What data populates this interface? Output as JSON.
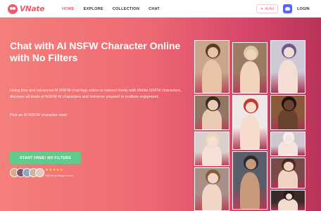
{
  "header": {
    "logo_text": "VNate",
    "nav": [
      {
        "label": "HOME",
        "active": true
      },
      {
        "label": "EXPLORE",
        "active": false
      },
      {
        "label": "COLLECTION",
        "active": false
      },
      {
        "label": "CHAT",
        "active": false
      }
    ],
    "ai_button_label": "AI Art",
    "login_label": "LOGIN"
  },
  "hero": {
    "title": "Chat with AI NSFW Character Online with No Filters",
    "description": "Using free and advanced AI NSFW chat App online to interact freely with lifelike NSFW characters, discover all kinds of NSFW AI characters and immerse yourself in endless enjoyment.",
    "cta_text": "Pick an AI NSFW character now!",
    "start_button_label": "START FREE! NO FILTERS",
    "stars": "★★★★★",
    "loved_text": "Still Been Ways Loved"
  },
  "colors": {
    "accent": "#ee5a6f",
    "hero_gradient_start": "#f47f7a",
    "hero_gradient_end": "#b9335a",
    "start_button": "#5fcb8c"
  },
  "gallery": [
    {
      "name": "character-image-1",
      "bg": "#c9a58a",
      "skin": "#e8c3a5",
      "hair": "#5a3a2a"
    },
    {
      "name": "character-image-2",
      "bg": "#9a7a63",
      "skin": "#f1d2bb",
      "hair": "#d9c9a2"
    },
    {
      "name": "character-image-3",
      "bg": "#cfc8d6",
      "skin": "#f4ddd4",
      "hair": "#6b5a8e"
    },
    {
      "name": "character-image-4",
      "bg": "#8f7763",
      "skin": "#e9cbb3",
      "hair": "#3a2a22"
    },
    {
      "name": "character-image-5",
      "bg": "#efe7e6",
      "skin": "#f6dccd",
      "hair": "#c23a2e"
    },
    {
      "name": "character-image-6",
      "bg": "#8a5a3a",
      "skin": "#6a4330",
      "hair": "#1f1410"
    },
    {
      "name": "character-image-7",
      "bg": "#d9d0ce",
      "skin": "#f6e0d6",
      "hair": "#ead9b2"
    },
    {
      "name": "character-image-8",
      "bg": "#5a5d6a",
      "skin": "#c89a7c",
      "hair": "#2a2a2a"
    },
    {
      "name": "character-image-9",
      "bg": "#cfc6d2",
      "skin": "#f5e4dd",
      "hair": "#f0f0f2"
    },
    {
      "name": "character-image-10",
      "bg": "#a89088",
      "skin": "#f0d6c6",
      "hair": "#8a5c3a"
    },
    {
      "name": "character-image-11",
      "bg": "#7a4a4a",
      "skin": "#f0d2c2",
      "hair": "#4a2a20"
    },
    {
      "name": "character-image-12",
      "bg": "#3a2a2a",
      "skin": "#f2dccf",
      "hair": "#2a1a14"
    }
  ]
}
